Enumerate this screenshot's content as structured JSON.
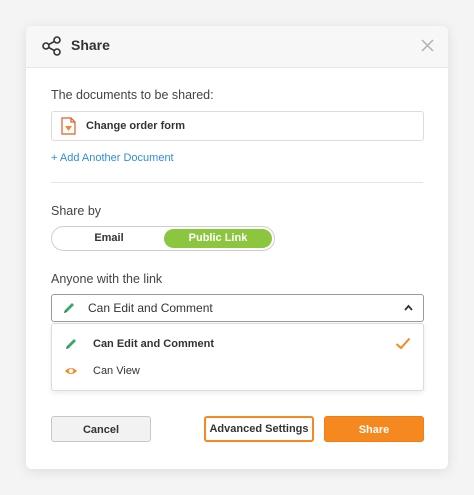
{
  "dialog": {
    "title": "Share",
    "documents_label": "The documents to be shared:",
    "document_name": "Change order form",
    "add_document_label": "+ Add Another Document",
    "share_by_label": "Share by",
    "share_options": [
      "Email",
      "Public Link"
    ],
    "share_selected": "Public Link",
    "link_label": "Anyone with the link",
    "permission_selected": "Can Edit and Comment",
    "permission_options": [
      "Can Edit and Comment",
      "Can View"
    ],
    "buttons": {
      "cancel": "Cancel",
      "advanced": "Advanced Settings",
      "share": "Share"
    }
  },
  "icons": {
    "header": "share-icon",
    "close": "close-icon",
    "document": "pdf-document-icon",
    "edit": "pencil-icon",
    "view": "eye-icon",
    "selected": "checkmark-icon"
  },
  "colors": {
    "accent": "#f5881f",
    "toggle_active": "#8cc63f",
    "link": "#2f8fd8",
    "pencil": "#3aa66a"
  }
}
